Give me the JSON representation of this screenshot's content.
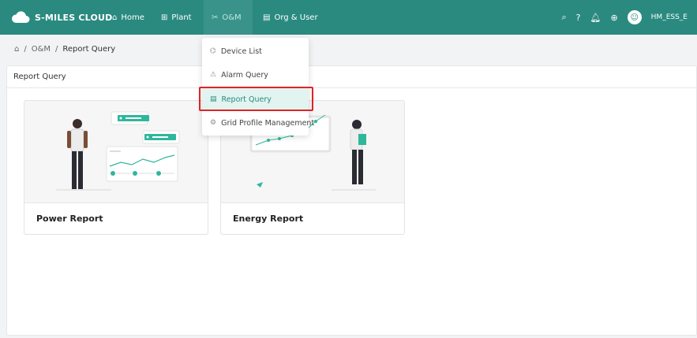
{
  "app": {
    "brand": "S-MILES CLOUD"
  },
  "nav": {
    "items": [
      {
        "label": "Home",
        "icon": "home-icon"
      },
      {
        "label": "Plant",
        "icon": "plant-icon"
      },
      {
        "label": "O&M",
        "icon": "tools-icon"
      },
      {
        "label": "Org & User",
        "icon": "org-icon"
      }
    ],
    "user": "HM_ESS_E"
  },
  "breadcrumb": {
    "home_icon": "home-icon",
    "sep": "/",
    "parent": "O&M",
    "current": "Report Query"
  },
  "panel": {
    "title": "Report Query"
  },
  "cards": [
    {
      "title": "Power Report"
    },
    {
      "title": "Energy Report"
    }
  ],
  "dropdown": {
    "items": [
      {
        "label": "Device List",
        "icon": "device-icon"
      },
      {
        "label": "Alarm Query",
        "icon": "alarm-icon"
      },
      {
        "label": "Report Query",
        "icon": "report-icon",
        "active": true
      },
      {
        "label": "Grid Profile Management",
        "icon": "grid-icon"
      }
    ]
  },
  "colors": {
    "primary": "#2a8a80",
    "highlight": "#e02424"
  }
}
